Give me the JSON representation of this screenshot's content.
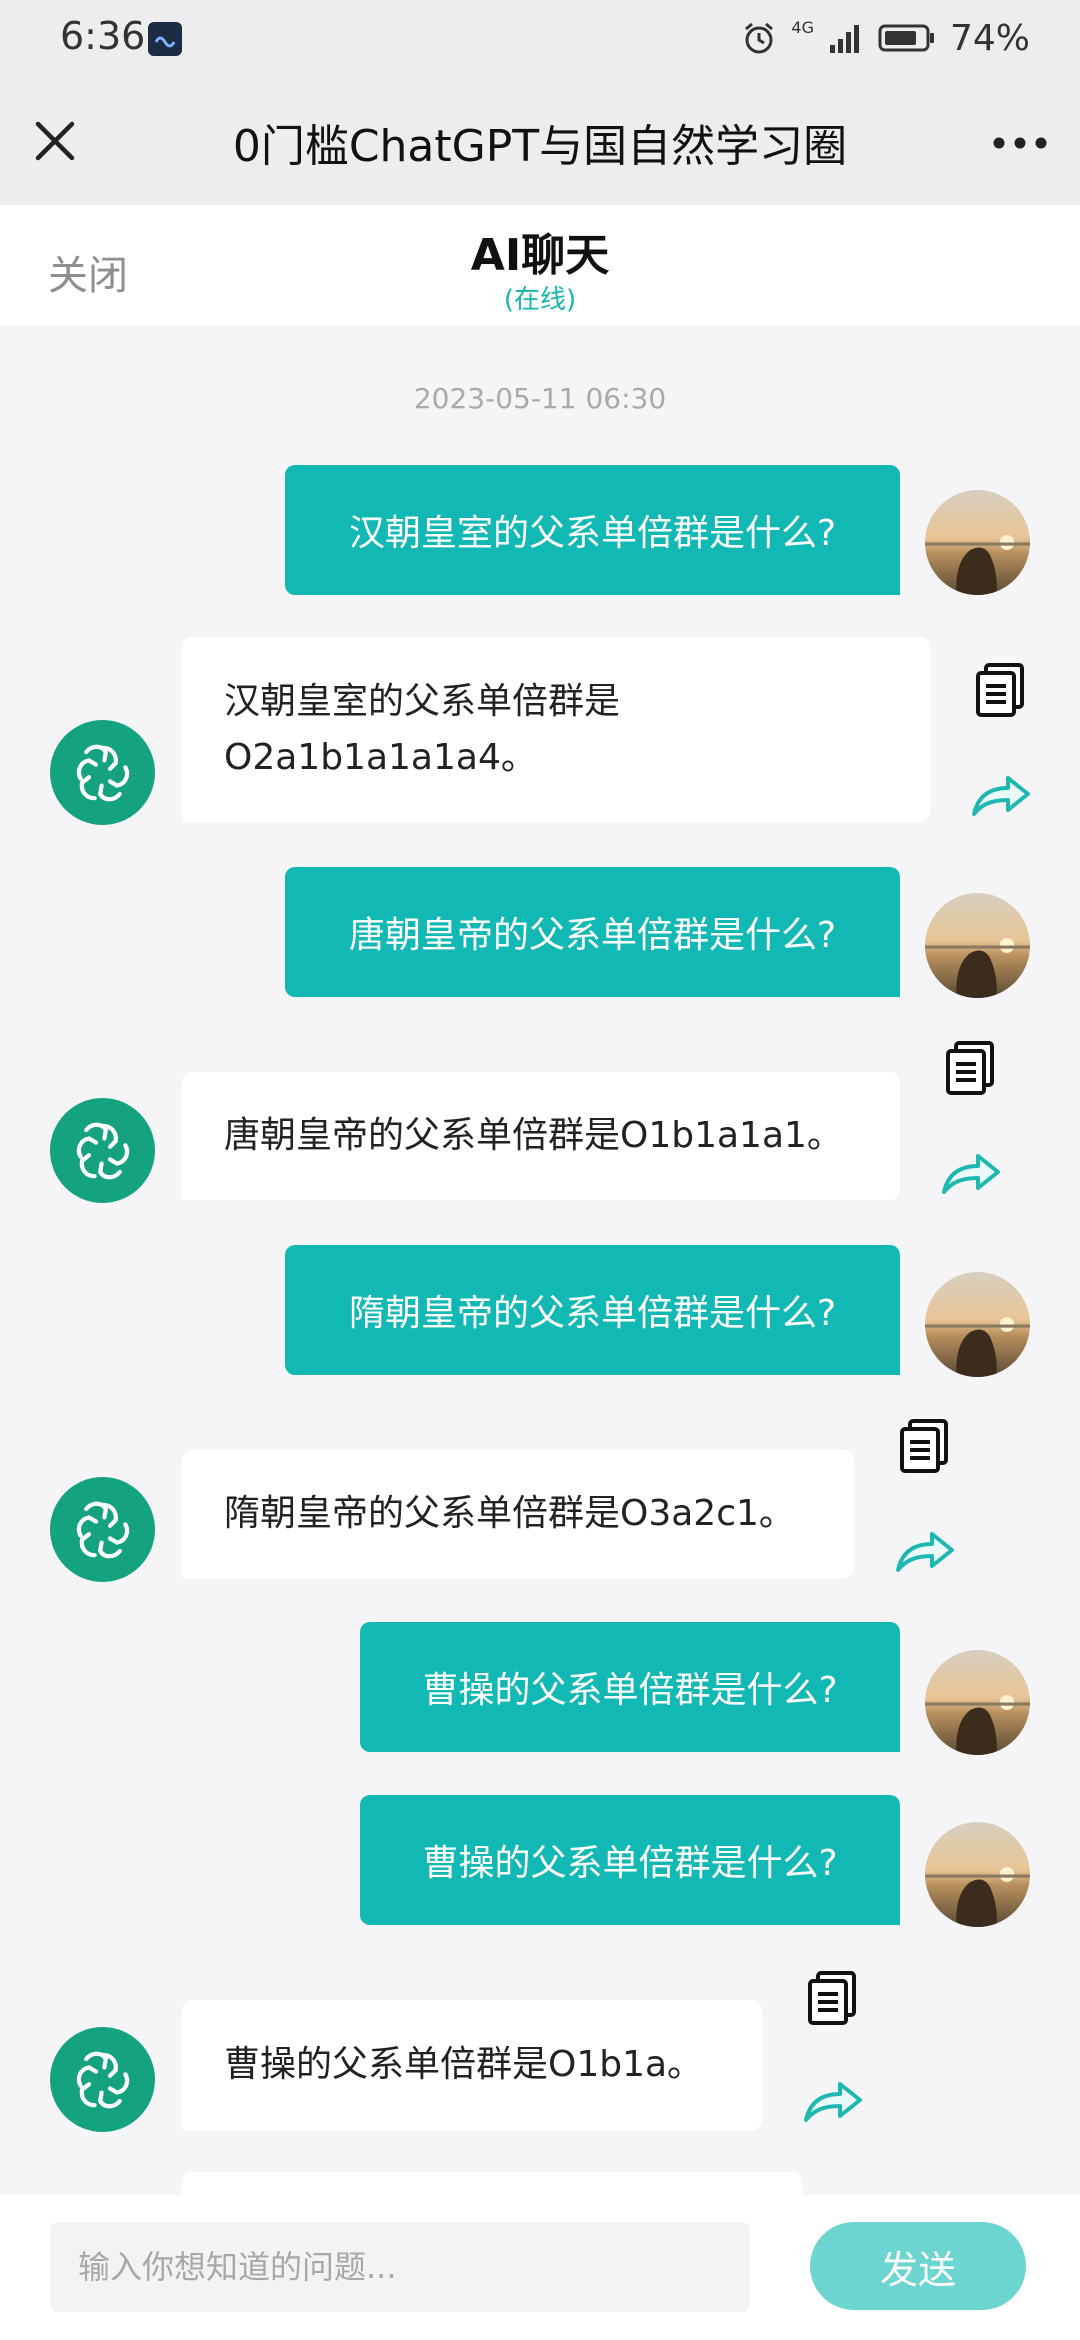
{
  "status_bar": {
    "time": "6:36",
    "network": "4G",
    "battery": "74%"
  },
  "nav": {
    "title": "0门槛ChatGPT与国自然学习圈"
  },
  "chat_header": {
    "close_label": "关闭",
    "title": "AI聊天",
    "status": "(在线)"
  },
  "timestamp": "2023-05-11 06:30",
  "messages": [
    {
      "role": "user",
      "text": "汉朝皇室的父系单倍群是什么?"
    },
    {
      "role": "ai",
      "text": "汉朝皇室的父系单倍群是O2a1b1a1a1a4。"
    },
    {
      "role": "user",
      "text": "唐朝皇帝的父系单倍群是什么?"
    },
    {
      "role": "ai",
      "text": "唐朝皇帝的父系单倍群是O1b1a1a1。"
    },
    {
      "role": "user",
      "text": "隋朝皇帝的父系单倍群是什么?"
    },
    {
      "role": "ai",
      "text": "隋朝皇帝的父系单倍群是O3a2c1。"
    },
    {
      "role": "user",
      "text": "曹操的父系单倍群是什么?"
    },
    {
      "role": "user",
      "text": "曹操的父系单倍群是什么?"
    },
    {
      "role": "ai",
      "text": "曹操的父系单倍群是O1b1a。"
    }
  ],
  "composer": {
    "placeholder": "输入你想知道的问题...",
    "send_label": "发送"
  },
  "colors": {
    "accent": "#12b9b4",
    "ai_avatar": "#15a37f",
    "send_button": "#6cd5cf"
  }
}
